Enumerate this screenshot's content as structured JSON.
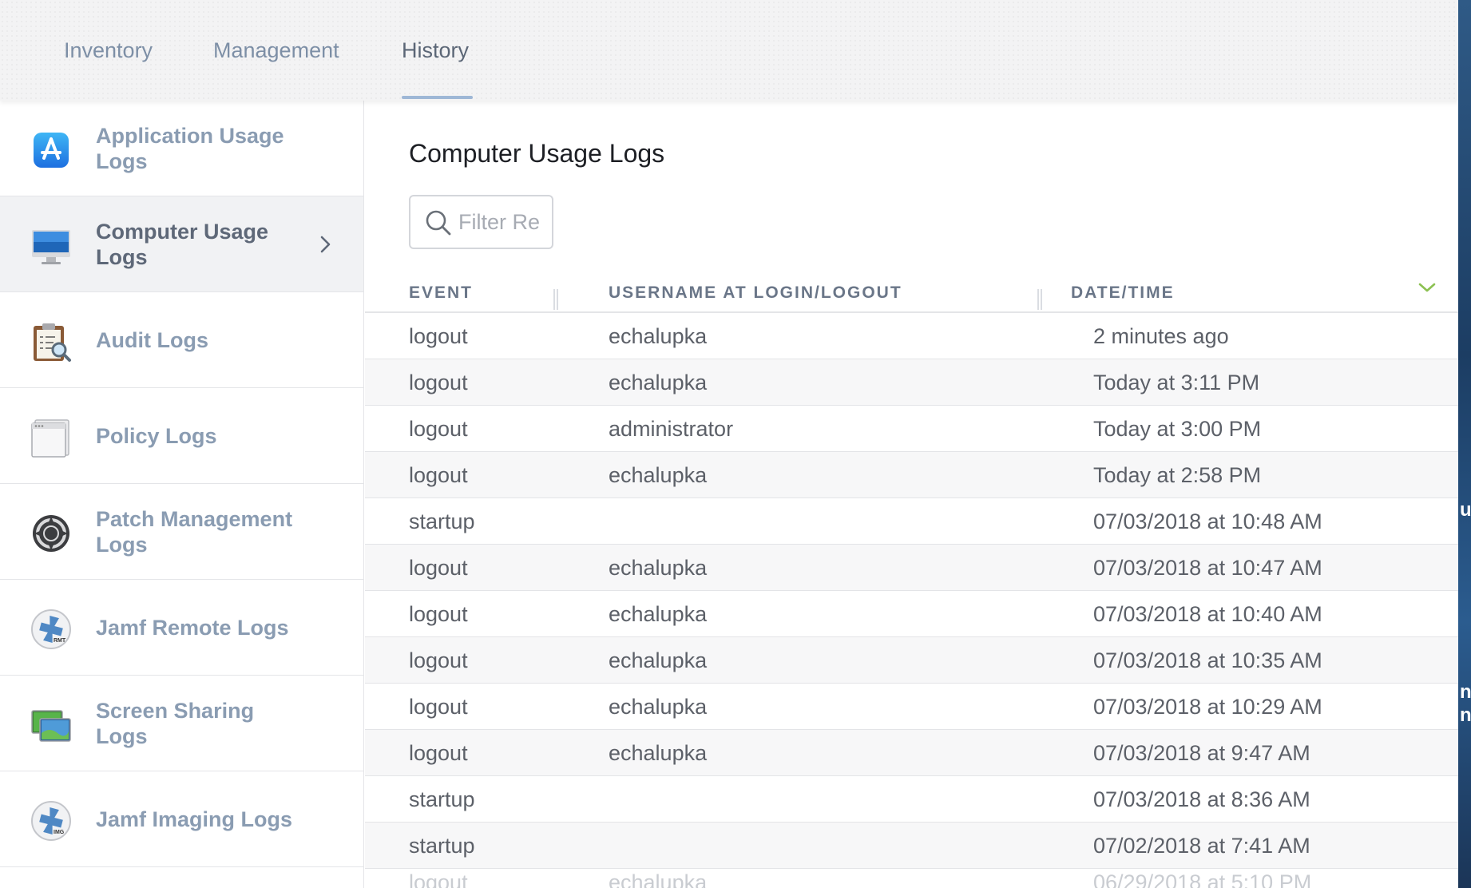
{
  "tabs": [
    {
      "label": "Inventory"
    },
    {
      "label": "Management"
    },
    {
      "label": "History"
    }
  ],
  "active_tab": "History",
  "sidebar": {
    "items": [
      {
        "label": "Application Usage Logs",
        "icon": "app-store-icon"
      },
      {
        "label": "Computer Usage Logs",
        "icon": "imac-icon",
        "selected": true
      },
      {
        "label": "Audit Logs",
        "icon": "clipboard-magnifier-icon"
      },
      {
        "label": "Policy Logs",
        "icon": "window-icon"
      },
      {
        "label": "Patch Management Logs",
        "icon": "patch-gear-icon"
      },
      {
        "label": "Jamf Remote Logs",
        "icon": "jamf-remote-icon",
        "badge": "RMT"
      },
      {
        "label": "Screen Sharing Logs",
        "icon": "screen-sharing-icon"
      },
      {
        "label": "Jamf Imaging Logs",
        "icon": "jamf-imaging-icon",
        "badge": "IMG"
      }
    ]
  },
  "main": {
    "title": "Computer Usage Logs",
    "filter_placeholder": "Filter Re",
    "columns": {
      "event": "EVENT",
      "username": "USERNAME AT LOGIN/LOGOUT",
      "datetime": "DATE/TIME"
    },
    "rows": [
      {
        "event": "logout",
        "username": "echalupka",
        "datetime": "2 minutes ago"
      },
      {
        "event": "logout",
        "username": "echalupka",
        "datetime": "Today at 3:11 PM"
      },
      {
        "event": "logout",
        "username": "administrator",
        "datetime": "Today at 3:00 PM"
      },
      {
        "event": "logout",
        "username": "echalupka",
        "datetime": "Today at 2:58 PM"
      },
      {
        "event": "startup",
        "username": "",
        "datetime": "07/03/2018 at 10:48 AM"
      },
      {
        "event": "logout",
        "username": "echalupka",
        "datetime": "07/03/2018 at 10:47 AM"
      },
      {
        "event": "logout",
        "username": "echalupka",
        "datetime": "07/03/2018 at 10:40 AM"
      },
      {
        "event": "logout",
        "username": "echalupka",
        "datetime": "07/03/2018 at 10:35 AM"
      },
      {
        "event": "logout",
        "username": "echalupka",
        "datetime": "07/03/2018 at 10:29 AM"
      },
      {
        "event": "logout",
        "username": "echalupka",
        "datetime": "07/03/2018 at 9:47 AM"
      },
      {
        "event": "startup",
        "username": "",
        "datetime": "07/03/2018 at 8:36 AM"
      },
      {
        "event": "startup",
        "username": "",
        "datetime": "07/02/2018 at 7:41 AM"
      },
      {
        "event": "logout",
        "username": "echalupka",
        "datetime": "06/29/2018 at 5:10 PM"
      }
    ]
  },
  "edge_fragments": [
    "ua",
    "n",
    "n"
  ],
  "colors": {
    "accent_underline": "#9eb7d6",
    "sort_chevron": "#8cc152",
    "sidebar_text": "#8a9cb2"
  }
}
